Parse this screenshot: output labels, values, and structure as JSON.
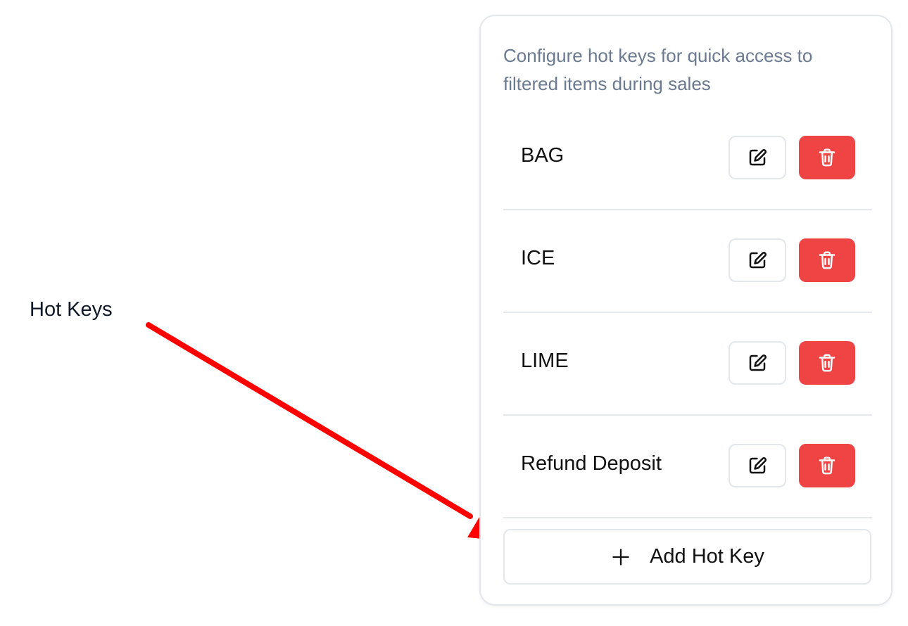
{
  "annotation": {
    "label": "Hot Keys",
    "arrow_color": "#ff0000"
  },
  "panel": {
    "description": "Configure hot keys for quick access to filtered items during sales",
    "hotkeys": [
      {
        "name": "BAG"
      },
      {
        "name": "ICE"
      },
      {
        "name": "LIME"
      },
      {
        "name": "Refund Deposit"
      }
    ],
    "edit_icon": "pencil-square-icon",
    "delete_icon": "trash-icon",
    "delete_color": "#ef4444",
    "add_button": {
      "icon": "plus-icon",
      "label": "Add Hot Key"
    }
  }
}
